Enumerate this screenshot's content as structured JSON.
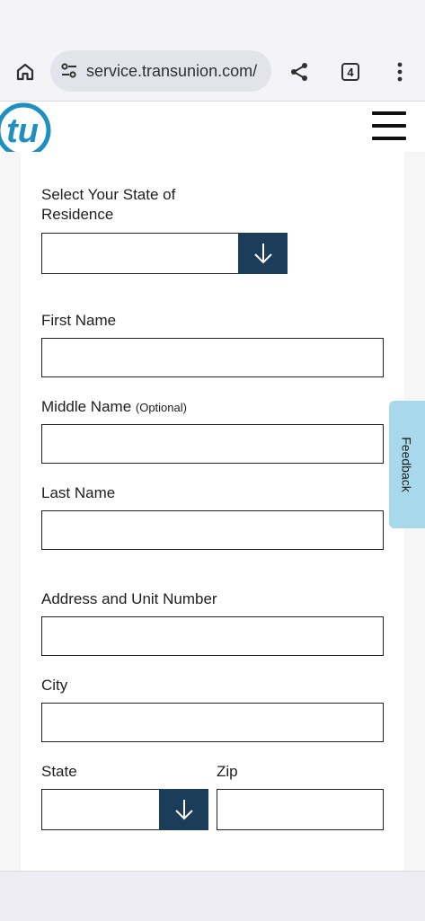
{
  "browser": {
    "url": "service.transunion.com/",
    "tab_count": "4"
  },
  "header": {
    "logo_text": "tu"
  },
  "form": {
    "state_of_residence_label_line1": "Select Your State of",
    "state_of_residence_label_line2": "Residence",
    "first_name_label": "First Name",
    "middle_name_label": "Middle Name",
    "middle_name_optional": "(Optional)",
    "last_name_label": "Last Name",
    "address_label": "Address and Unit Number",
    "city_label": "City",
    "state_label": "State",
    "zip_label": "Zip"
  },
  "feedback": {
    "label": "Feedback"
  },
  "colors": {
    "accent": "#1c3d5a",
    "logo": "#1d8fc0",
    "feedback_bg": "#a8d8ec"
  }
}
